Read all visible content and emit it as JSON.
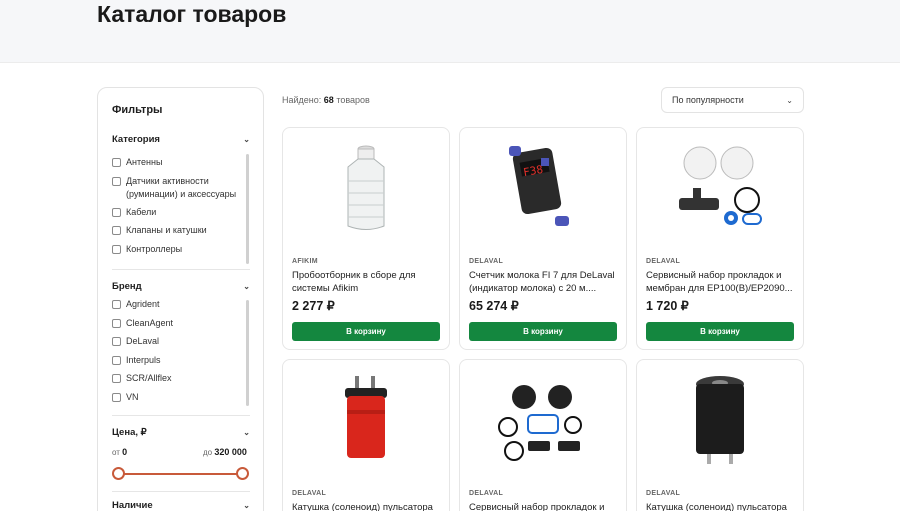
{
  "page": {
    "title": "Каталог товаров"
  },
  "filters": {
    "title": "Фильтры",
    "category": {
      "title": "Категория",
      "items": [
        "Антенны",
        "Датчики активности (руминации) и аксессуары",
        "Кабели",
        "Клапаны и катушки",
        "Контроллеры"
      ]
    },
    "brand": {
      "title": "Бренд",
      "items": [
        "Agrident",
        "CleanAgent",
        "DeLaval",
        "Interpuls",
        "SCR/Allflex",
        "VN"
      ]
    },
    "price": {
      "title": "Цена, ₽",
      "from_prefix": "от",
      "from_value": "0",
      "to_prefix": "до",
      "to_value": "320 000"
    },
    "availability": {
      "title": "Наличие"
    }
  },
  "results": {
    "found_prefix": "Найдено:",
    "count": "68",
    "found_suffix": "товаров"
  },
  "sort": {
    "selected": "По популярности"
  },
  "buy_label": "В корзину",
  "products": [
    {
      "brand": "AFIKIM",
      "name": "Пробоотборник в сборе для системы Afikim",
      "price": "2 277 ₽",
      "icon": "sampler-image"
    },
    {
      "brand": "DELAVAL",
      "name": "Счетчик молока FI 7 для DeLaval (индикатор молока) с 20 м....",
      "price": "65 274 ₽",
      "icon": "milk-meter-image"
    },
    {
      "brand": "DELAVAL",
      "name": "Сервисный набор прокладок и мембран для EP100(B)/EP2090...",
      "price": "1 720 ₽",
      "icon": "gasket-kit-image"
    },
    {
      "brand": "DELAVAL",
      "name": "Катушка (соленоид) пульсатора",
      "price": "",
      "icon": "red-solenoid-image"
    },
    {
      "brand": "DELAVAL",
      "name": "Сервисный набор прокладок и",
      "price": "",
      "icon": "gasket-kit-black-image"
    },
    {
      "brand": "DELAVAL",
      "name": "Катушка (соленоид) пульсатора",
      "price": "",
      "icon": "black-solenoid-image"
    }
  ],
  "colors": {
    "accent_green": "#14873f",
    "slider": "#c85a3a",
    "header_bg": "#f6f7f9"
  }
}
